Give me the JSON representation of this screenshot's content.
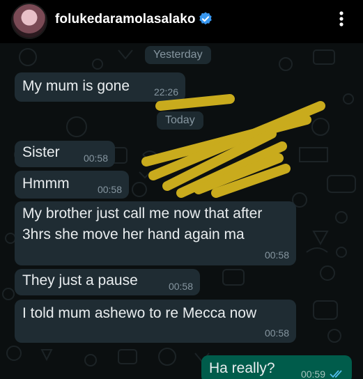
{
  "header": {
    "username": "folukedaramolasalako",
    "verified": true,
    "menu_icon": "more-vertical-icon"
  },
  "colors": {
    "incoming_bubble": "#1f2c33",
    "outgoing_bubble": "#005c4b",
    "scribble": "#d4b41e",
    "read_ticks": "#53bdeb"
  },
  "chat": {
    "date_yesterday": "Yesterday",
    "date_today": "Today",
    "messages": [
      {
        "text": "My mum is gone",
        "time": "22:26"
      },
      {
        "text": "Sister",
        "time": "00:58"
      },
      {
        "text": "Hmmm",
        "time": "00:58"
      },
      {
        "text": "My brother just call me now that after 3hrs she move her hand again ma",
        "time": "00:58"
      },
      {
        "text": "They just a pause",
        "time": "00:58"
      },
      {
        "text": "I told mum ashewo to re Mecca now",
        "time": "00:58"
      },
      {
        "text": "Ha really?",
        "time": "00:59",
        "status": "read"
      }
    ]
  }
}
